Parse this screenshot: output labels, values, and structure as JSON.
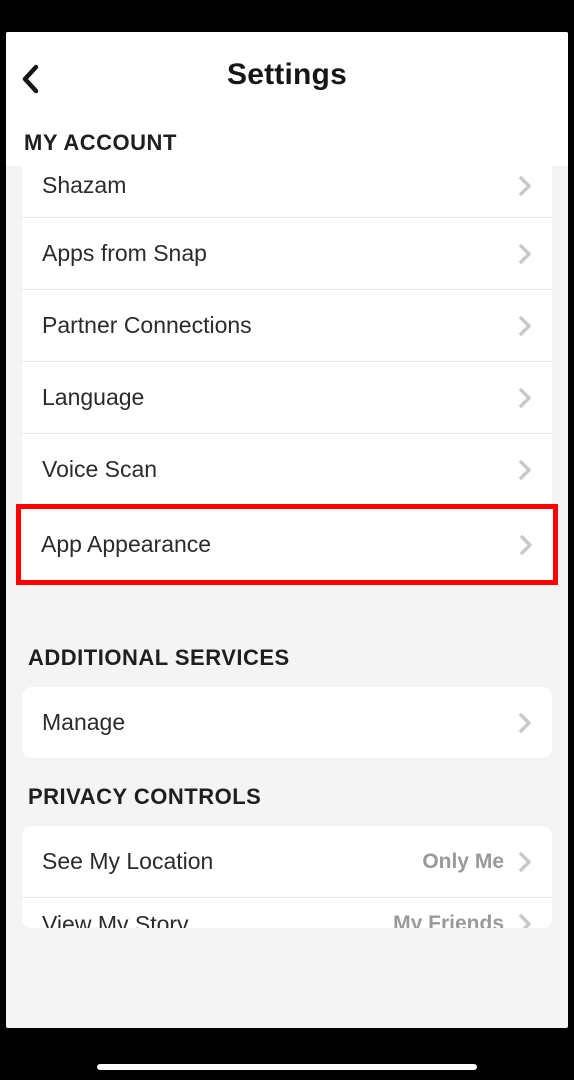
{
  "header": {
    "title": "Settings"
  },
  "sections": {
    "my_account": {
      "title": "MY ACCOUNT",
      "rows": {
        "shazam": "Shazam",
        "apps_from_snap": "Apps from Snap",
        "partner_connections": "Partner Connections",
        "language": "Language",
        "voice_scan": "Voice Scan",
        "app_appearance": "App Appearance"
      }
    },
    "additional_services": {
      "title": "ADDITIONAL SERVICES",
      "rows": {
        "manage": "Manage"
      }
    },
    "privacy_controls": {
      "title": "PRIVACY CONTROLS",
      "rows": {
        "see_my_location": {
          "label": "See My Location",
          "value": "Only Me"
        },
        "view_my_story": {
          "label": "View My Story",
          "value": "My Friends"
        }
      }
    }
  },
  "highlight": "app_appearance"
}
